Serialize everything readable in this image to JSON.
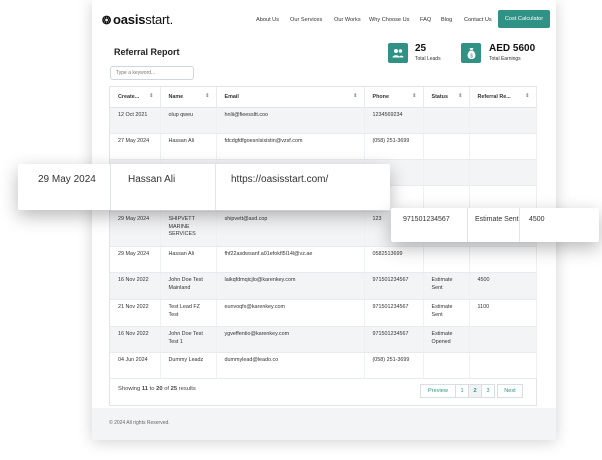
{
  "brand": {
    "name_bold": "oasis",
    "name_light": "start."
  },
  "nav": {
    "links": [
      "About Us",
      "Our Services",
      "Our Works",
      "Why Choose Us",
      "FAQ",
      "Blog",
      "Contact Us"
    ],
    "cta": "Cost Calculator"
  },
  "report": {
    "title": "Referral Report",
    "search_placeholder": "Type a keyword..."
  },
  "stats": {
    "leads_value": "25",
    "leads_label": "Total Leads",
    "earnings_value": "AED 5600",
    "earnings_label": "Total Earnings"
  },
  "table": {
    "headers": [
      "Create...",
      "Name",
      "Email",
      "Phone",
      "Status",
      "Referral Re..."
    ],
    "rows": [
      {
        "created": "12 Oct 2021",
        "name": "olup qweu",
        "email": "hnlii@fieessltt.coo",
        "phone": "1234569234",
        "status": "",
        "reward": ""
      },
      {
        "created": "27 May 2024",
        "name": "Hassan Ali",
        "email": "fdcdgfdfgoesnlsixistin@vzsf.com",
        "phone": "(058) 251-3699",
        "status": "",
        "reward": ""
      },
      {
        "created": "",
        "name": "",
        "email": "",
        "phone": "3699",
        "status": "",
        "reward": ""
      },
      {
        "created": "",
        "name": "",
        "email": "",
        "phone": "3699",
        "status": "",
        "reward": ""
      },
      {
        "created": "29 May 2024",
        "name": "SHIPVETT MARINE SERVICES",
        "email": "shipvett@asd.cop",
        "phone": "123",
        "status": "",
        "reward": ""
      },
      {
        "created": "29 May 2024",
        "name": "Hassan Ali",
        "email": "fhf22asdwsanf.a01efokfl5l14l@vz.ae",
        "phone": "0582513699",
        "status": "",
        "reward": ""
      },
      {
        "created": "16 Nov 2022",
        "name": "John Doe Test Mainland",
        "email": "laikqfdmqicjlo@karenkey.com",
        "phone": "971501234567",
        "status": "Estimate Sent",
        "reward": "4500"
      },
      {
        "created": "21 Nov 2022",
        "name": "Test Lead FZ Test",
        "email": "eunvoqfx@karenkey.com",
        "phone": "971501234567",
        "status": "Estimate Sent",
        "reward": "1100"
      },
      {
        "created": "16 Nov 2022",
        "name": "John Doe Test Test 1",
        "email": "ygveffentio@karenkey.com",
        "phone": "971501234567",
        "status": "Estimate Opened",
        "reward": ""
      },
      {
        "created": "04 Jun 2024",
        "name": "Dummy Leadz",
        "email": "dummylead@leado.co",
        "phone": "(058) 251-3699",
        "status": "",
        "reward": ""
      }
    ]
  },
  "pagination": {
    "showing_prefix": "Showing",
    "from": "11",
    "to_word": "to",
    "to": "20",
    "of_word": "of",
    "total": "25",
    "suffix": "results",
    "prev": "Preview",
    "pages": [
      "1",
      "2",
      "3"
    ],
    "next": "Next"
  },
  "footer": {
    "copyright": "© 2024 All rights Reserved."
  },
  "zoom_left": {
    "created": "29 May 2024",
    "name": "Hassan Ali",
    "email": "https://oasisstart.com/"
  },
  "zoom_right": {
    "phone": "971501234567",
    "status": "Estimate Sent",
    "reward": "4500"
  },
  "colors": {
    "accent": "#2f9284"
  }
}
